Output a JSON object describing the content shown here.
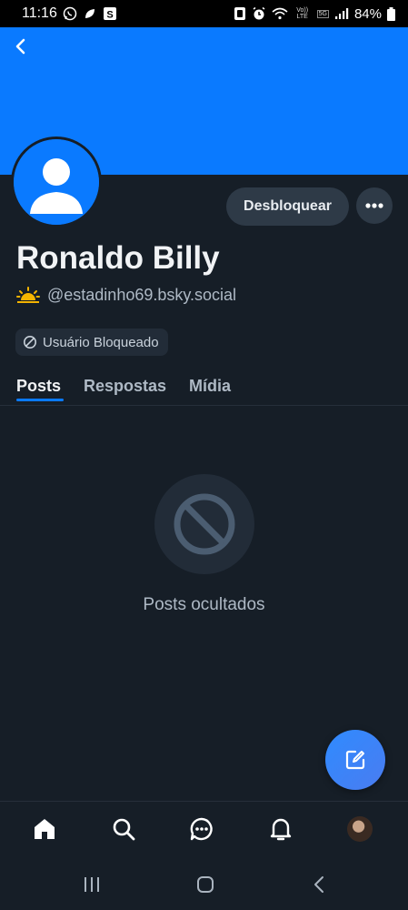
{
  "status_bar": {
    "time": "11:16",
    "battery": "84%",
    "network_label": "Vo)) LTE",
    "network_5g": "5G"
  },
  "profile": {
    "display_name": "Ronaldo Billy",
    "handle": "@estadinho69.bsky.social",
    "blocked_label": "Usuário Bloqueado",
    "unblock_label": "Desbloquear"
  },
  "tabs": [
    {
      "label": "Posts",
      "active": true
    },
    {
      "label": "Respostas",
      "active": false
    },
    {
      "label": "Mídia",
      "active": false
    }
  ],
  "empty_state": {
    "message": "Posts ocultados"
  },
  "bottom_nav": [
    "home-icon",
    "search-icon",
    "chat-icon",
    "bell-icon",
    "profile-avatar"
  ],
  "colors": {
    "accent": "#0a7aff",
    "background": "#161e27",
    "surface": "#2e3a47"
  }
}
